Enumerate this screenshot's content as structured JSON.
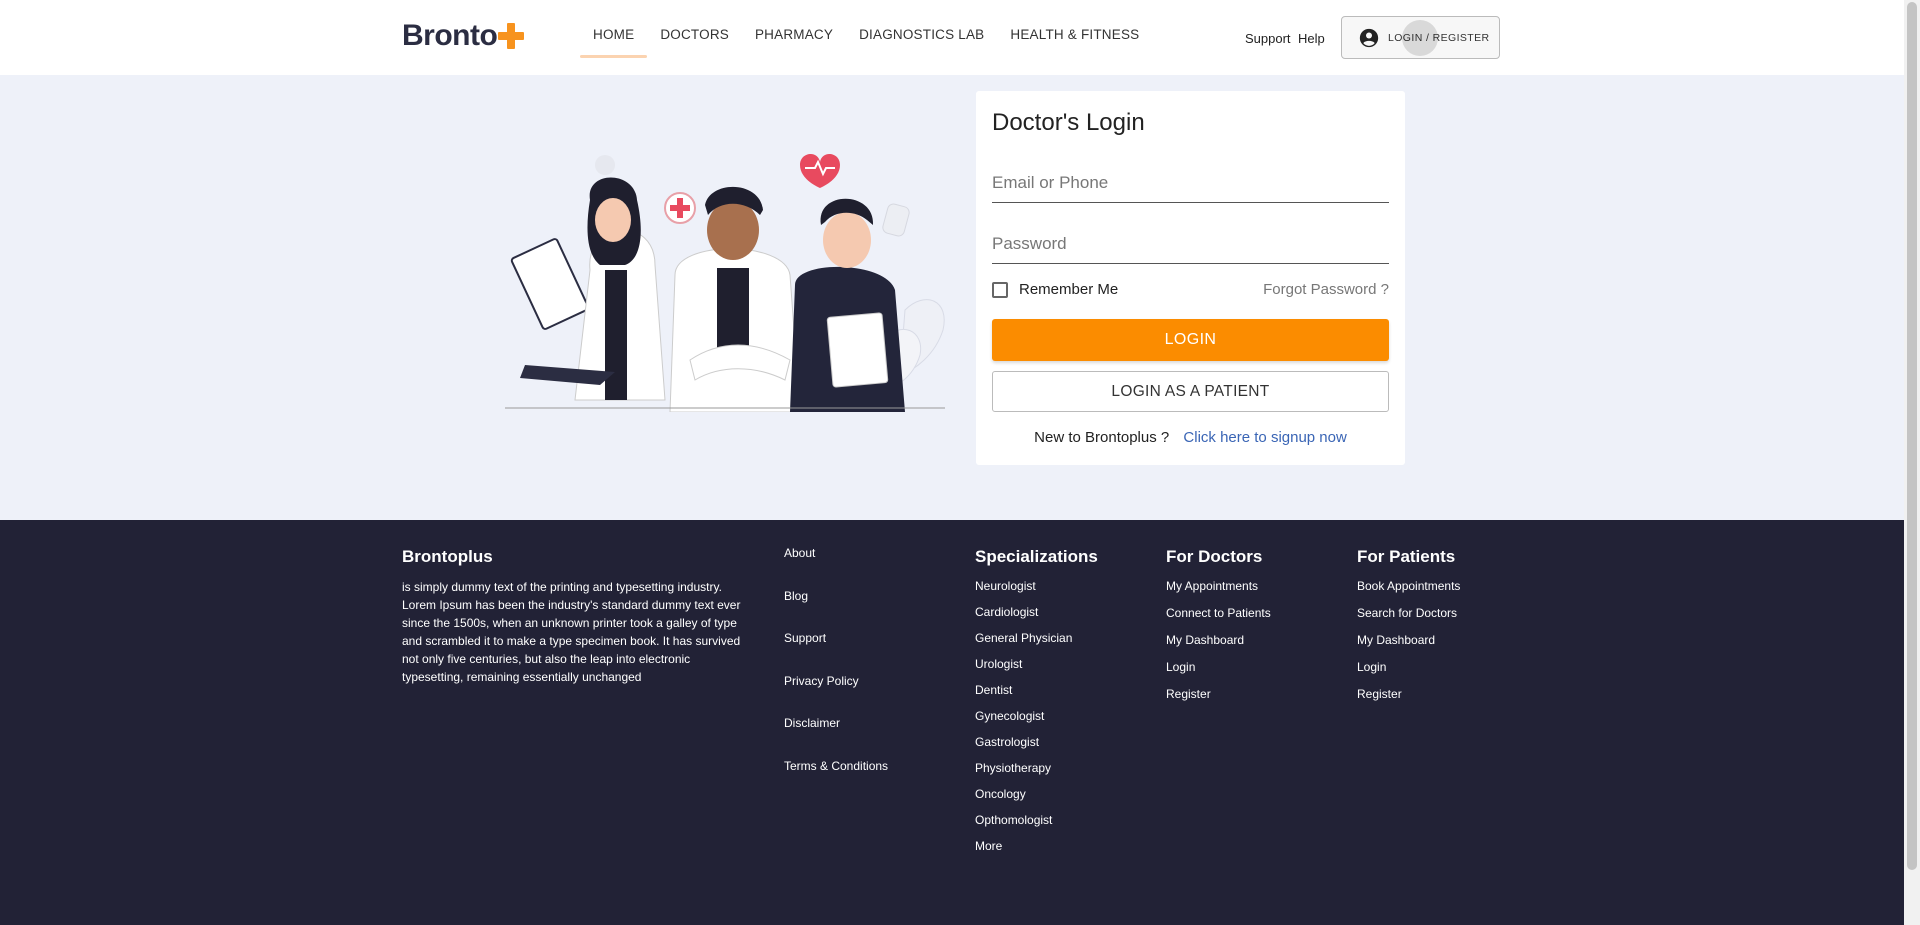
{
  "header": {
    "logo_text": "Bronto",
    "nav": [
      "HOME",
      "DOCTORS",
      "PHARMACY",
      "DIAGNOSTICS LAB",
      "HEALTH & FITNESS"
    ],
    "support": "Support",
    "help": "Help",
    "login_register": "LOGIN / REGISTER"
  },
  "login": {
    "title": "Doctor's Login",
    "email_placeholder": "Email or Phone",
    "password_placeholder": "Password",
    "remember_me": "Remember Me",
    "forgot_password": "Forgot Password ?",
    "login_button": "LOGIN",
    "patient_button": "LOGIN AS A PATIENT",
    "new_user_text": "New to Brontoplus ?",
    "signup_link": "Click here to signup now"
  },
  "footer": {
    "brand": "Brontoplus",
    "description": "is simply dummy text of the printing and typesetting industry. Lorem Ipsum has been the industry's standard dummy text ever since the 1500s, when an unknown printer took a galley of type and scrambled it to make a type specimen book. It has survived not only five centuries, but also the leap into electronic typesetting, remaining essentially unchanged",
    "about_links": [
      "About",
      "Blog",
      "Support",
      "Privacy Policy",
      "Disclaimer",
      "Terms & Conditions"
    ],
    "specializations": {
      "heading": "Specializations",
      "items": [
        "Neurologist",
        "Cardiologist",
        "General Physician",
        "Urologist",
        "Dentist",
        "Gynecologist",
        "Gastrologist",
        "Physiotherapy",
        "Oncology",
        "Opthomologist",
        "More"
      ]
    },
    "for_doctors": {
      "heading": "For Doctors",
      "items": [
        "My Appointments",
        "Connect to Patients",
        "My Dashboard",
        "Login",
        "Register"
      ]
    },
    "for_patients": {
      "heading": "For Patients",
      "items": [
        "Book Appointments",
        "Search for Doctors",
        "My Dashboard",
        "Login",
        "Register"
      ]
    }
  },
  "colors": {
    "accent": "#fb8c00",
    "footer_bg": "#222236",
    "page_bg": "#eef1f9",
    "link": "#3a65b5"
  },
  "icons": {
    "account": "account-circle-icon",
    "checkbox": "checkbox-unchecked-icon"
  }
}
